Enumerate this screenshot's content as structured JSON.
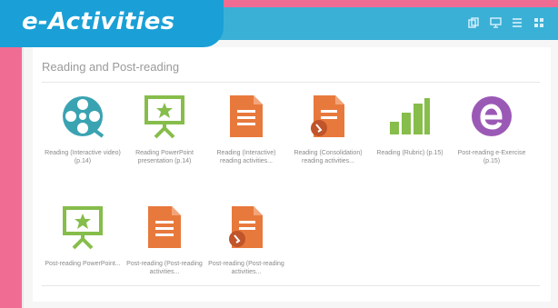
{
  "badge": {
    "label": "e-Activities"
  },
  "topbar": {
    "icons": [
      "copy-icon",
      "monitor-icon",
      "list-icon",
      "grid-icon"
    ]
  },
  "section": {
    "title": "Reading and Post-reading"
  },
  "tiles_row1": [
    {
      "icon": "film-reel-icon",
      "label": "Reading (Interactive video) (p.14)"
    },
    {
      "icon": "presentation-icon",
      "label": "Reading PowerPoint presentation (p.14)"
    },
    {
      "icon": "document-icon",
      "label": "Reading (Interactive) reading activities..."
    },
    {
      "icon": "document-badge-icon",
      "label": "Reading (Consolidation) reading activities..."
    },
    {
      "icon": "bar-chart-icon",
      "label": "Reading (Rubric) (p.15)"
    },
    {
      "icon": "e-circle-icon",
      "label": "Post-reading e-Exercise (p.15)"
    }
  ],
  "tiles_row2": [
    {
      "icon": "presentation-icon",
      "label": "Post-reading PowerPoint..."
    },
    {
      "icon": "document-icon",
      "label": "Post-reading (Post-reading activities..."
    },
    {
      "icon": "document-badge-icon",
      "label": "Post-reading (Post-reading activities..."
    }
  ],
  "colors": {
    "frame": "#f06c93",
    "topbar": "#3bb0d6",
    "badge": "#1aa0d6",
    "teal": "#3aa3b2",
    "green": "#86bd4b",
    "orange": "#e8793c",
    "purple": "#9b59b6"
  }
}
